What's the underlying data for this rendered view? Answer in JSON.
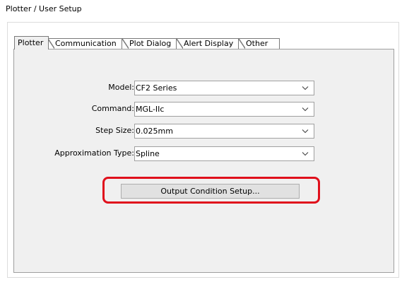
{
  "window": {
    "title": "Plotter / User Setup"
  },
  "tabs": [
    {
      "label": "Plotter",
      "active": true
    },
    {
      "label": "Communication",
      "active": false
    },
    {
      "label": "Plot Dialog",
      "active": false
    },
    {
      "label": "Alert Display",
      "active": false
    },
    {
      "label": "Other",
      "active": false
    }
  ],
  "form": {
    "model": {
      "label": "Model:",
      "value": "CF2 Series"
    },
    "command": {
      "label": "Command:",
      "value": "MGL-IIc"
    },
    "step_size": {
      "label": "Step Size:",
      "value": "0.025mm"
    },
    "approximation_type": {
      "label": "Approximation Type:",
      "value": "Spline"
    }
  },
  "buttons": {
    "output_condition_setup": "Output Condition Setup..."
  },
  "colors": {
    "highlight_outline": "#e0101c",
    "panel_background": "#f0f0f0",
    "button_background": "#e1e1e1"
  },
  "icons": {
    "dropdown": "chevron-down-icon"
  }
}
